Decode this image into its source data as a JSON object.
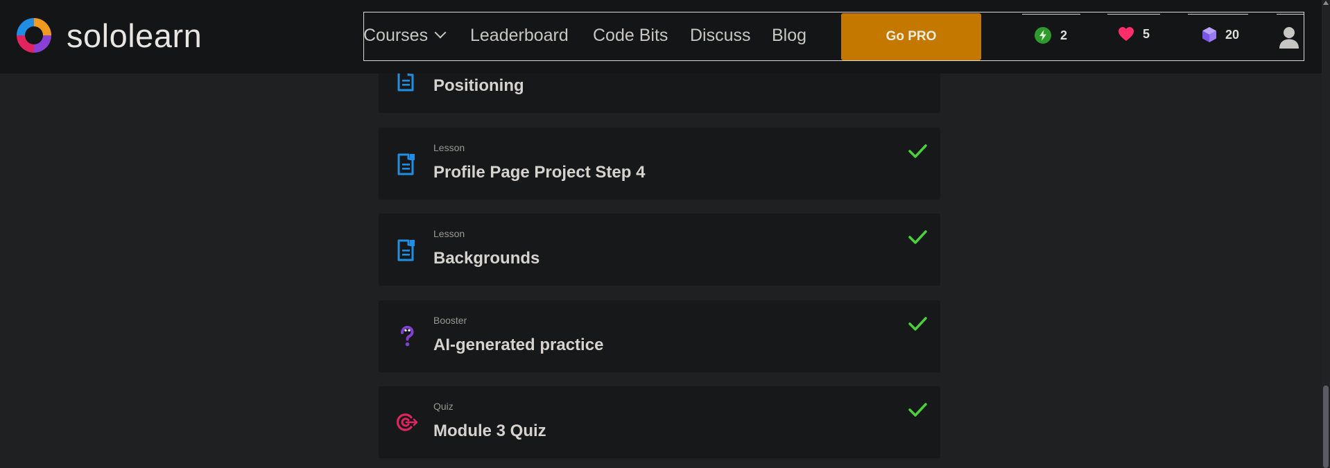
{
  "brand": {
    "name": "sololearn"
  },
  "nav": {
    "courses": "Courses",
    "leaderboard": "Leaderboard",
    "code_bits": "Code Bits",
    "discuss": "Discuss",
    "blog": "Blog",
    "go_pro": "Go PRO"
  },
  "stats": {
    "streak": {
      "value": "2",
      "icon": "lightning-icon",
      "color": "#2e9a2e"
    },
    "hearts": {
      "value": "5",
      "icon": "heart-icon",
      "color": "#ff2d6a"
    },
    "gems": {
      "value": "20",
      "icon": "gem-icon",
      "color": "#8f6cf0"
    }
  },
  "items": [
    {
      "type": "",
      "title": "Positioning",
      "icon": "lesson-icon",
      "completed": false
    },
    {
      "type": "Lesson",
      "title": "Profile Page Project Step 4",
      "icon": "lesson-icon",
      "completed": true
    },
    {
      "type": "Lesson",
      "title": "Backgrounds",
      "icon": "lesson-icon",
      "completed": true
    },
    {
      "type": "Booster",
      "title": "AI-generated practice",
      "icon": "booster-icon",
      "completed": true
    },
    {
      "type": "Quiz",
      "title": "Module 3 Quiz",
      "icon": "quiz-target-icon",
      "completed": true
    }
  ],
  "colors": {
    "background": "#1e2022",
    "header": "#141517",
    "card": "#17181a",
    "accent_pro": "#c57800",
    "lesson_icon": "#1f8fe6",
    "booster_icon": "#8040d0",
    "quiz_icon": "#e0245e",
    "check": "#4bd13c"
  }
}
